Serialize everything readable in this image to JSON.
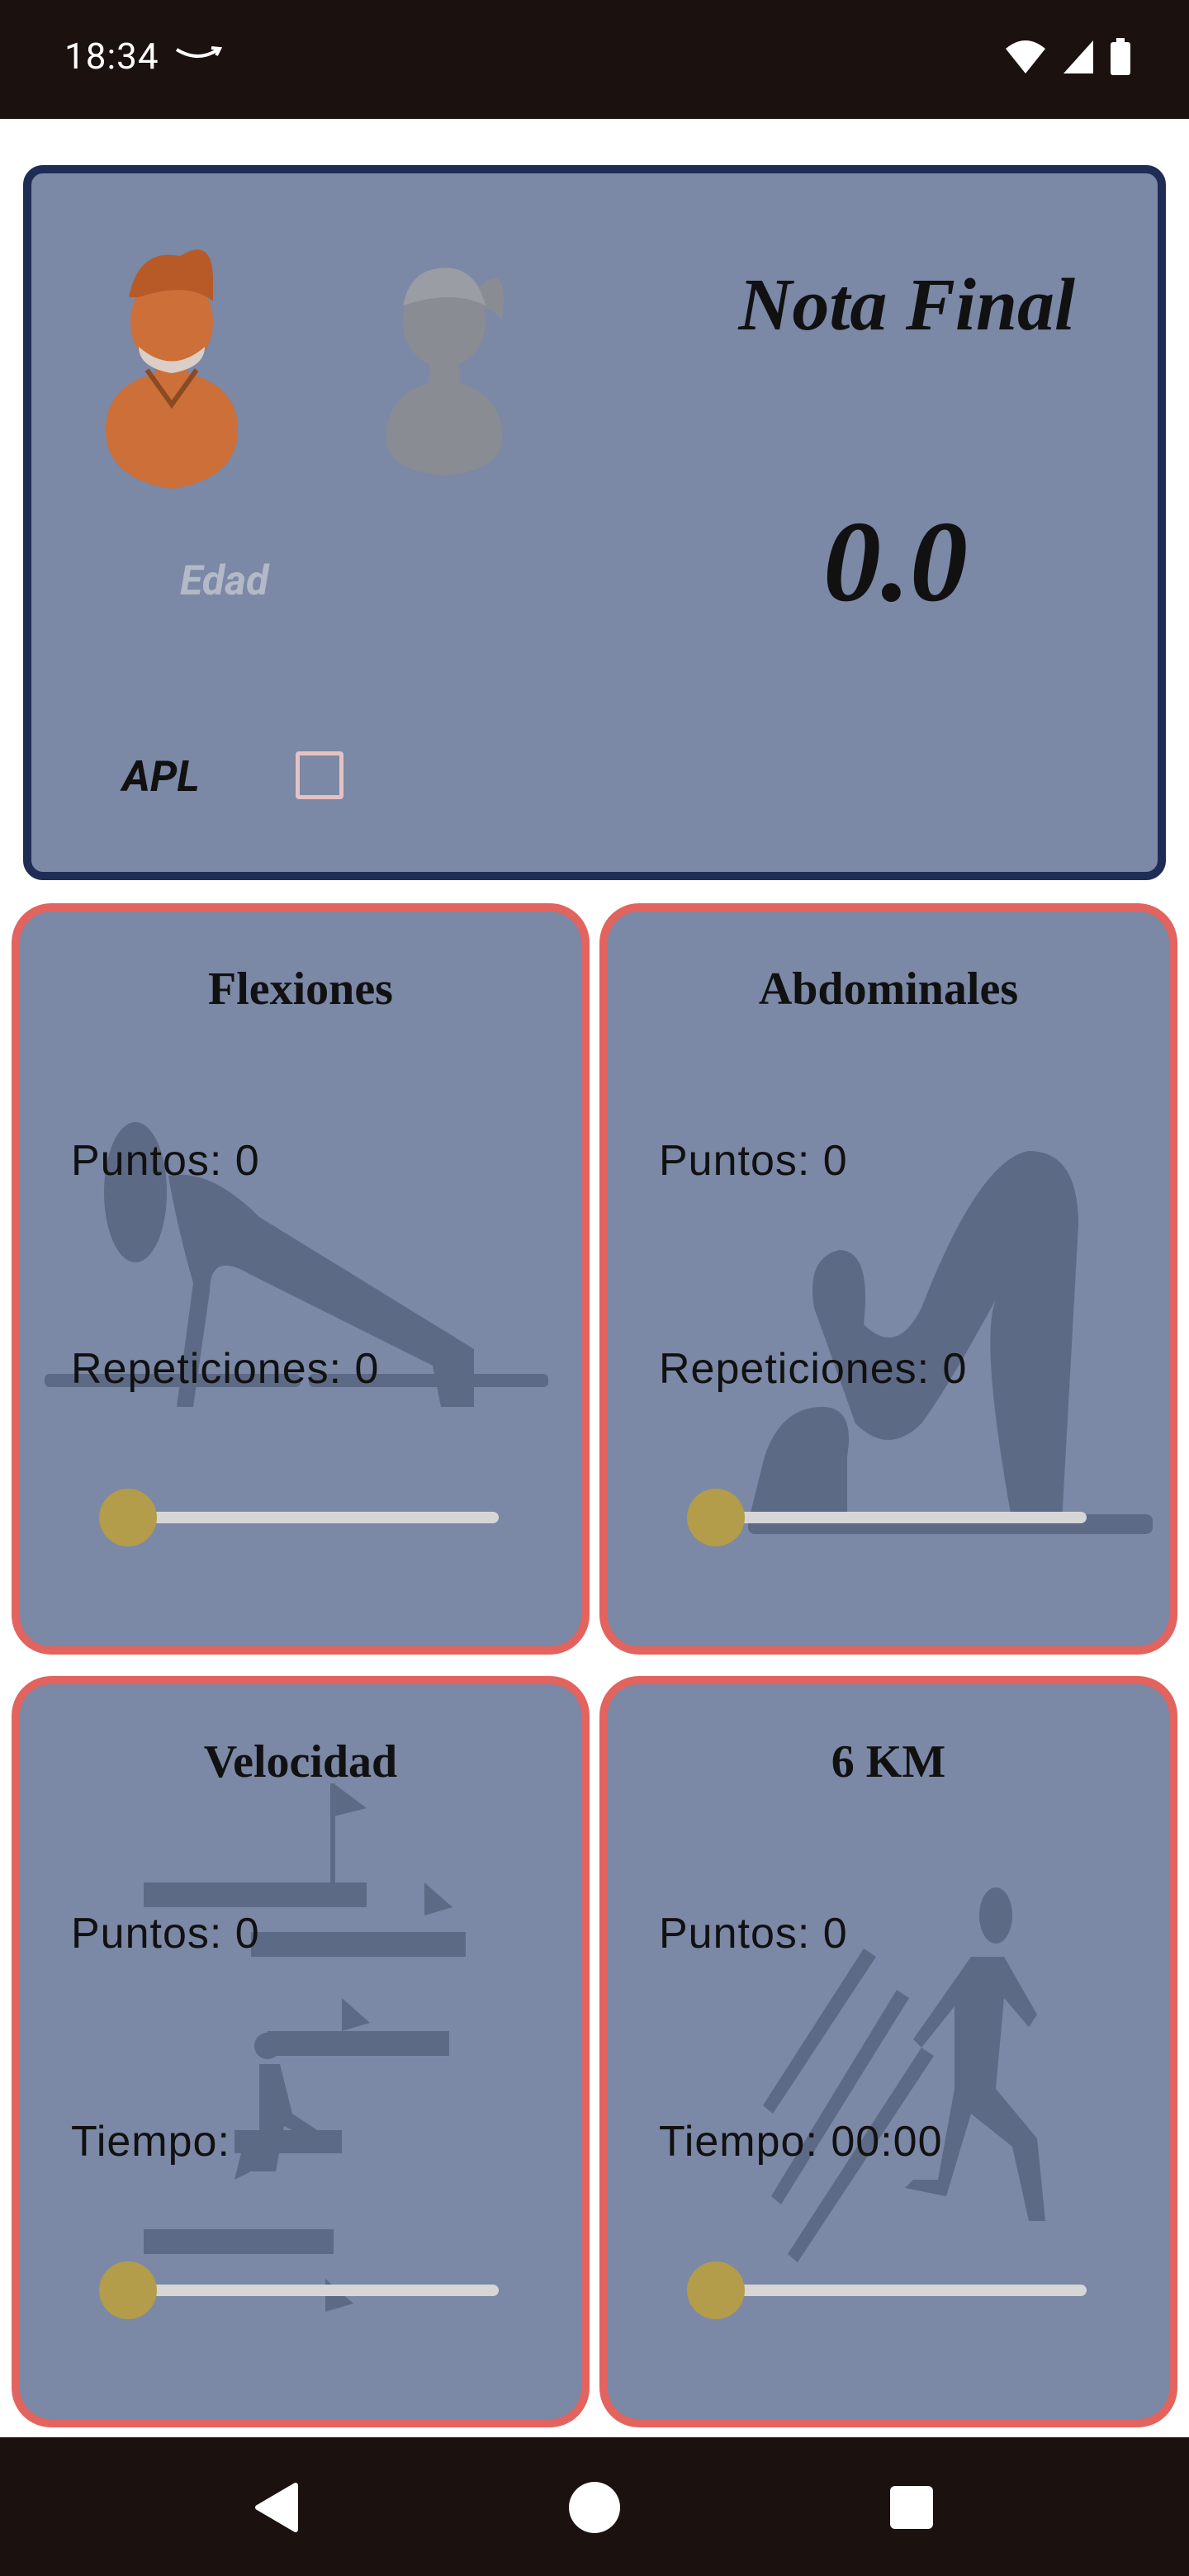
{
  "status_bar": {
    "time": "18:34"
  },
  "summary": {
    "title": "Nota Final",
    "score": "0.0",
    "age_placeholder": "Edad",
    "apl_label": "APL",
    "apl_checked": false,
    "gender_selected": "male"
  },
  "cards": [
    {
      "title": "Flexiones",
      "points_label": "Puntos:  0",
      "metric_label": "Repeticiones: 0",
      "slider_value": 0,
      "icon": "push-up-icon"
    },
    {
      "title": "Abdominales",
      "points_label": "Puntos:  0",
      "metric_label": "Repeticiones: 0",
      "slider_value": 0,
      "icon": "sit-up-icon"
    },
    {
      "title": "Velocidad",
      "points_label": "Puntos:  0",
      "metric_label": "Tiempo:",
      "slider_value": 0,
      "icon": "sprint-course-icon"
    },
    {
      "title": "6 KM",
      "points_label": "Puntos:  0",
      "metric_label": "Tiempo: 00:00",
      "slider_value": 0,
      "icon": "runner-icon"
    }
  ],
  "colors": {
    "panel_bg": "#7b88a6",
    "top_border": "#1f2c55",
    "card_border": "#e3635e",
    "slider_thumb": "#b39c4a",
    "male_icon": "#cc6f38",
    "female_icon": "#8a8c94"
  }
}
